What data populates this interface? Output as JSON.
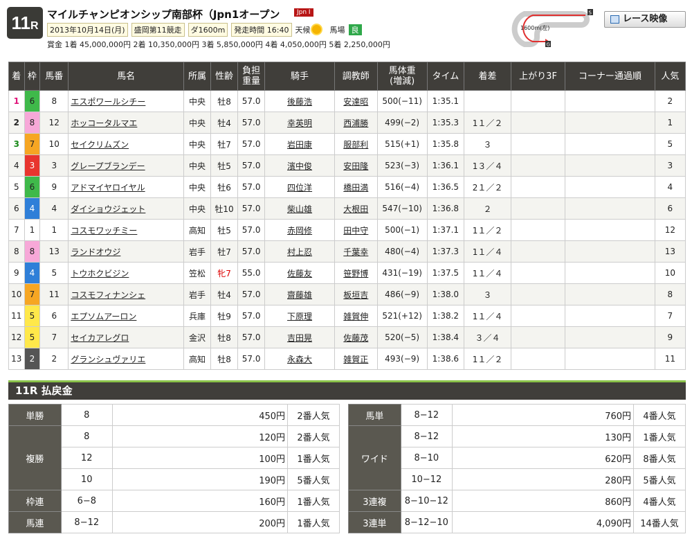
{
  "race": {
    "no": "11",
    "r": "R",
    "title": "マイルチャンピオンシップ南部杯（Jpn1オープン",
    "grade": "Jpn I",
    "date": "2013年10月14日(月)",
    "meeting": "盛岡第11競走",
    "course": "ダ1600m",
    "start": "発走時間 16:40",
    "weather_label": "天候",
    "track_label": "馬場",
    "track_cond": "良",
    "prize": "賞金 1着 45,000,000円 2着 10,350,000円 3着 5,850,000円 4着 4,050,000円 5着 2,250,000円",
    "course_map_label": "1600m(左)",
    "course_start": "S",
    "course_goal": "G",
    "video_button": "レース映像"
  },
  "table": {
    "headers": [
      "着",
      "枠",
      "馬番",
      "馬名",
      "所属",
      "性齢",
      "負担\n重量",
      "騎手",
      "調教師",
      "馬体重\n(増減)",
      "タイム",
      "着差",
      "上がり3F",
      "コーナー通過順",
      "人気"
    ],
    "rows": [
      {
        "pos": "1",
        "waku": "6",
        "uma": "8",
        "name": "エスポワールシチー",
        "aff": "中央",
        "sex": "牡8",
        "wt": "57.0",
        "jockey": "後藤浩",
        "trainer": "安達昭",
        "body": "500(−11)",
        "time": "1:35.1",
        "margin": "",
        "agari": "",
        "corner": "",
        "pop": "2"
      },
      {
        "pos": "2",
        "waku": "8",
        "uma": "12",
        "name": "ホッコータルマエ",
        "aff": "中央",
        "sex": "牡4",
        "wt": "57.0",
        "jockey": "幸英明",
        "trainer": "西浦勝",
        "body": "499(−2)",
        "time": "1:35.3",
        "margin": "1１／２",
        "agari": "",
        "corner": "",
        "pop": "1"
      },
      {
        "pos": "3",
        "waku": "7",
        "uma": "10",
        "name": "セイクリムズン",
        "aff": "中央",
        "sex": "牡7",
        "wt": "57.0",
        "jockey": "岩田康",
        "trainer": "服部利",
        "body": "515(+1)",
        "time": "1:35.8",
        "margin": "３",
        "agari": "",
        "corner": "",
        "pop": "5"
      },
      {
        "pos": "4",
        "waku": "3",
        "uma": "3",
        "name": "グレープブランデー",
        "aff": "中央",
        "sex": "牡5",
        "wt": "57.0",
        "jockey": "濱中俊",
        "trainer": "安田隆",
        "body": "523(−3)",
        "time": "1:36.1",
        "margin": "1３／４",
        "agari": "",
        "corner": "",
        "pop": "3"
      },
      {
        "pos": "5",
        "waku": "6",
        "uma": "9",
        "name": "アドマイヤロイヤル",
        "aff": "中央",
        "sex": "牡6",
        "wt": "57.0",
        "jockey": "四位洋",
        "trainer": "橋田満",
        "body": "516(−4)",
        "time": "1:36.5",
        "margin": "2１／２",
        "agari": "",
        "corner": "",
        "pop": "4"
      },
      {
        "pos": "6",
        "waku": "4",
        "uma": "4",
        "name": "ダイショウジェット",
        "aff": "中央",
        "sex": "牡10",
        "wt": "57.0",
        "jockey": "柴山雄",
        "trainer": "大根田",
        "body": "547(−10)",
        "time": "1:36.8",
        "margin": "２",
        "agari": "",
        "corner": "",
        "pop": "6"
      },
      {
        "pos": "7",
        "waku": "1",
        "uma": "1",
        "name": "コスモワッチミー",
        "aff": "高知",
        "sex": "牡5",
        "wt": "57.0",
        "jockey": "赤岡修",
        "trainer": "田中守",
        "body": "500(−1)",
        "time": "1:37.1",
        "margin": "1１／２",
        "agari": "",
        "corner": "",
        "pop": "12"
      },
      {
        "pos": "8",
        "waku": "8",
        "uma": "13",
        "name": "ランドオウジ",
        "aff": "岩手",
        "sex": "牡7",
        "wt": "57.0",
        "jockey": "村上忍",
        "trainer": "千葉幸",
        "body": "480(−4)",
        "time": "1:37.3",
        "margin": "1１／４",
        "agari": "",
        "corner": "",
        "pop": "13"
      },
      {
        "pos": "9",
        "waku": "4",
        "uma": "5",
        "name": "トウホクビジン",
        "aff": "笠松",
        "sex": "牝7",
        "wt": "55.0",
        "jockey": "佐藤友",
        "trainer": "笹野博",
        "body": "431(−19)",
        "time": "1:37.5",
        "margin": "1１／４",
        "agari": "",
        "corner": "",
        "pop": "10"
      },
      {
        "pos": "10",
        "waku": "7",
        "uma": "11",
        "name": "コスモフィナンシェ",
        "aff": "岩手",
        "sex": "牡4",
        "wt": "57.0",
        "jockey": "齋藤雄",
        "trainer": "板垣吉",
        "body": "486(−9)",
        "time": "1:38.0",
        "margin": "３",
        "agari": "",
        "corner": "",
        "pop": "8"
      },
      {
        "pos": "11",
        "waku": "5",
        "uma": "6",
        "name": "エプソムアーロン",
        "aff": "兵庫",
        "sex": "牡9",
        "wt": "57.0",
        "jockey": "下原理",
        "trainer": "雑賀伸",
        "body": "521(+12)",
        "time": "1:38.2",
        "margin": "1１／４",
        "agari": "",
        "corner": "",
        "pop": "7"
      },
      {
        "pos": "12",
        "waku": "5",
        "uma": "7",
        "name": "セイカアレグロ",
        "aff": "金沢",
        "sex": "牡8",
        "wt": "57.0",
        "jockey": "吉田晃",
        "trainer": "佐藤茂",
        "body": "520(−5)",
        "time": "1:38.4",
        "margin": "３／４",
        "agari": "",
        "corner": "",
        "pop": "9"
      },
      {
        "pos": "13",
        "waku": "2",
        "uma": "2",
        "name": "グランシュヴァリエ",
        "aff": "高知",
        "sex": "牡8",
        "wt": "57.0",
        "jockey": "永森大",
        "trainer": "雑賀正",
        "body": "493(−9)",
        "time": "1:38.6",
        "margin": "1１／２",
        "agari": "",
        "corner": "",
        "pop": "11"
      }
    ]
  },
  "waku_colors": {
    "1": "#ffffff",
    "2": "#555555",
    "3": "#e8352e",
    "4": "#2f7fd8",
    "5": "#ffe84a",
    "6": "#3fb94a",
    "7": "#f6a623",
    "8": "#f7a8d8"
  },
  "waku_text": {
    "1": "#222",
    "2": "#fff",
    "3": "#fff",
    "4": "#fff",
    "5": "#222",
    "6": "#222",
    "7": "#222",
    "8": "#222"
  },
  "payout": {
    "title": "11R 払戻金",
    "left": [
      {
        "type": "単勝",
        "rows": [
          [
            "8",
            "450円",
            "2番人気"
          ]
        ]
      },
      {
        "type": "複勝",
        "rows": [
          [
            "8",
            "120円",
            "2番人気"
          ],
          [
            "12",
            "100円",
            "1番人気"
          ],
          [
            "10",
            "190円",
            "5番人気"
          ]
        ]
      },
      {
        "type": "枠連",
        "rows": [
          [
            "6−8",
            "160円",
            "1番人気"
          ]
        ]
      },
      {
        "type": "馬連",
        "rows": [
          [
            "8−12",
            "200円",
            "1番人気"
          ]
        ]
      }
    ],
    "right": [
      {
        "type": "馬単",
        "rows": [
          [
            "8−12",
            "760円",
            "4番人気"
          ]
        ]
      },
      {
        "type": "ワイド",
        "rows": [
          [
            "8−12",
            "130円",
            "1番人気"
          ],
          [
            "8−10",
            "620円",
            "8番人気"
          ],
          [
            "10−12",
            "280円",
            "5番人気"
          ]
        ]
      },
      {
        "type": "3連複",
        "rows": [
          [
            "8−10−12",
            "860円",
            "4番人気"
          ]
        ]
      },
      {
        "type": "3連単",
        "rows": [
          [
            "8−12−10",
            "4,090円",
            "14番人気"
          ]
        ]
      }
    ]
  }
}
